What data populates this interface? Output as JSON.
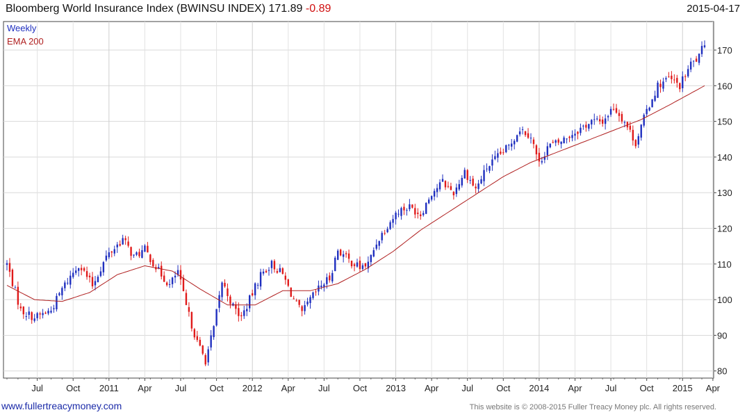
{
  "header": {
    "title": "Bloomberg World Insurance Index (BWINSU INDEX) 171.89",
    "change": "-0.89",
    "date": "2015-04-17"
  },
  "footer": {
    "site": "www.fullertreacymoney.com",
    "copyright": "This website is © 2008-2015 Fuller Treacy Money plc. All rights reserved."
  },
  "chart_data": {
    "type": "candlestick",
    "title": "Bloomberg World Insurance Index (BWINSU INDEX) 171.89 -0.89",
    "frequency_label": "Weekly",
    "overlay_label": "EMA 200",
    "y_axis_side": "right",
    "ylim": [
      78,
      178
    ],
    "y_ticks": [
      80,
      90,
      100,
      110,
      120,
      130,
      140,
      150,
      160,
      170
    ],
    "x_tick_labels": [
      "Jul",
      "Oct",
      "2011",
      "Apr",
      "Jul",
      "Oct",
      "2012",
      "Apr",
      "Jul",
      "Oct",
      "2013",
      "Apr",
      "Jul",
      "Oct",
      "2014",
      "Apr",
      "Jul",
      "Oct",
      "2015",
      "Apr"
    ],
    "grid": true,
    "colors": {
      "up": "#1f2fbf",
      "down": "#e01a1a",
      "ema": "#b02020"
    },
    "close_keypoints": [
      {
        "week": 0,
        "value": 110
      },
      {
        "week": 5,
        "value": 97
      },
      {
        "week": 10,
        "value": 95
      },
      {
        "week": 16,
        "value": 97
      },
      {
        "week": 20,
        "value": 103
      },
      {
        "week": 26,
        "value": 110
      },
      {
        "week": 31,
        "value": 104
      },
      {
        "week": 36,
        "value": 112
      },
      {
        "week": 42,
        "value": 117
      },
      {
        "week": 46,
        "value": 112
      },
      {
        "week": 50,
        "value": 114
      },
      {
        "week": 55,
        "value": 108
      },
      {
        "week": 59,
        "value": 104
      },
      {
        "week": 62,
        "value": 108
      },
      {
        "week": 65,
        "value": 98
      },
      {
        "week": 69,
        "value": 88
      },
      {
        "week": 72,
        "value": 83
      },
      {
        "week": 75,
        "value": 92
      },
      {
        "week": 78,
        "value": 105
      },
      {
        "week": 82,
        "value": 98
      },
      {
        "week": 85,
        "value": 95
      },
      {
        "week": 88,
        "value": 100
      },
      {
        "week": 92,
        "value": 107
      },
      {
        "week": 96,
        "value": 110
      },
      {
        "week": 100,
        "value": 107
      },
      {
        "week": 104,
        "value": 100
      },
      {
        "week": 107,
        "value": 96
      },
      {
        "week": 110,
        "value": 100
      },
      {
        "week": 114,
        "value": 104
      },
      {
        "week": 117,
        "value": 106
      },
      {
        "week": 120,
        "value": 114
      },
      {
        "week": 124,
        "value": 111
      },
      {
        "week": 128,
        "value": 109
      },
      {
        "week": 131,
        "value": 110
      },
      {
        "week": 134,
        "value": 116
      },
      {
        "week": 138,
        "value": 121
      },
      {
        "week": 142,
        "value": 125
      },
      {
        "week": 146,
        "value": 126
      },
      {
        "week": 150,
        "value": 124
      },
      {
        "week": 154,
        "value": 130
      },
      {
        "week": 158,
        "value": 133
      },
      {
        "week": 162,
        "value": 130
      },
      {
        "week": 166,
        "value": 136
      },
      {
        "week": 170,
        "value": 131
      },
      {
        "week": 174,
        "value": 137
      },
      {
        "week": 178,
        "value": 140
      },
      {
        "week": 182,
        "value": 143
      },
      {
        "week": 186,
        "value": 148
      },
      {
        "week": 190,
        "value": 146
      },
      {
        "week": 193,
        "value": 138
      },
      {
        "week": 196,
        "value": 143
      },
      {
        "week": 200,
        "value": 144
      },
      {
        "week": 204,
        "value": 146
      },
      {
        "week": 208,
        "value": 148
      },
      {
        "week": 212,
        "value": 150
      },
      {
        "week": 216,
        "value": 150
      },
      {
        "week": 220,
        "value": 154
      },
      {
        "week": 224,
        "value": 150
      },
      {
        "week": 228,
        "value": 144
      },
      {
        "week": 232,
        "value": 153
      },
      {
        "week": 236,
        "value": 160
      },
      {
        "week": 240,
        "value": 162
      },
      {
        "week": 244,
        "value": 160
      },
      {
        "week": 248,
        "value": 166
      },
      {
        "week": 251,
        "value": 168
      },
      {
        "week": 253,
        "value": 172
      }
    ],
    "ema200_keypoints": [
      {
        "week": 0,
        "value": 104
      },
      {
        "week": 10,
        "value": 100
      },
      {
        "week": 20,
        "value": 99.5
      },
      {
        "week": 30,
        "value": 102
      },
      {
        "week": 40,
        "value": 107
      },
      {
        "week": 50,
        "value": 109.5
      },
      {
        "week": 60,
        "value": 108
      },
      {
        "week": 70,
        "value": 103
      },
      {
        "week": 80,
        "value": 98.5
      },
      {
        "week": 90,
        "value": 98.5
      },
      {
        "week": 100,
        "value": 102.5
      },
      {
        "week": 110,
        "value": 102.5
      },
      {
        "week": 120,
        "value": 104.5
      },
      {
        "week": 130,
        "value": 108.5
      },
      {
        "week": 140,
        "value": 113.5
      },
      {
        "week": 150,
        "value": 119.5
      },
      {
        "week": 160,
        "value": 124.5
      },
      {
        "week": 170,
        "value": 129.5
      },
      {
        "week": 180,
        "value": 134.5
      },
      {
        "week": 190,
        "value": 138.5
      },
      {
        "week": 200,
        "value": 141.5
      },
      {
        "week": 210,
        "value": 144.5
      },
      {
        "week": 220,
        "value": 147.5
      },
      {
        "week": 230,
        "value": 150.5
      },
      {
        "week": 240,
        "value": 154.5
      },
      {
        "week": 253,
        "value": 160
      }
    ]
  }
}
